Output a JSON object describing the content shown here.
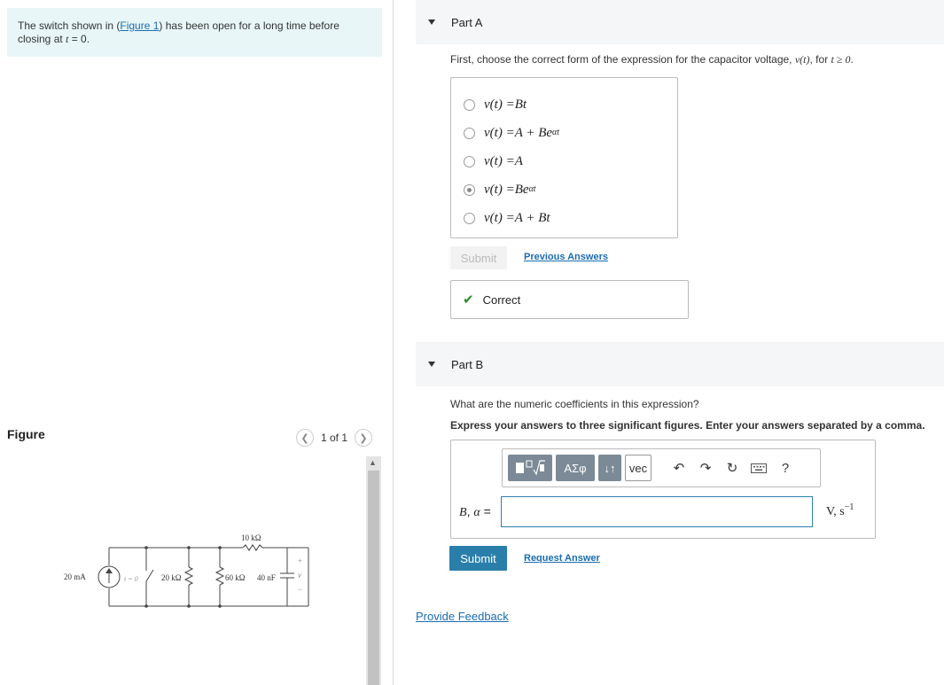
{
  "problem": {
    "text_before": "The switch shown in (",
    "figure_link": "Figure 1",
    "text_after": ") has been open for a long time before closing at ",
    "time_var": "t",
    "time_eq": " = 0."
  },
  "figure": {
    "label": "Figure",
    "pager": "1 of 1",
    "circuit": {
      "source": "20 mA",
      "switch": "t = 0",
      "r1": "20 kΩ",
      "r_top": "10 kΩ",
      "r2": "60 kΩ",
      "cap": "40 nF",
      "plus": "+",
      "v": "v",
      "minus": "−"
    }
  },
  "partA": {
    "title": "Part A",
    "question_prefix": "First, choose the correct form of the expression for the capacitor voltage, ",
    "question_var": "v(t)",
    "question_mid": ", for ",
    "question_cond": "t ≥ 0",
    "question_end": ".",
    "choices": [
      {
        "lhs": "v(t) = ",
        "rhs": "Bt",
        "sup": "",
        "selected": false
      },
      {
        "lhs": "v(t) = ",
        "rhs": "A + Be",
        "sup": "αt",
        "selected": false
      },
      {
        "lhs": "v(t) = ",
        "rhs": "A",
        "sup": "",
        "selected": false
      },
      {
        "lhs": "v(t) = ",
        "rhs": "Be",
        "sup": "αt",
        "selected": true
      },
      {
        "lhs": "v(t) = ",
        "rhs": "A + Bt",
        "sup": "",
        "selected": false
      }
    ],
    "submit_label": "Submit",
    "previous_answers": "Previous Answers",
    "result": "Correct"
  },
  "partB": {
    "title": "Part B",
    "question": "What are the numeric coefficients in this expression?",
    "instruction": "Express your answers to three significant figures. Enter your answers separated by a comma.",
    "toolbar": {
      "templates_icon": "templates-icon",
      "greek_label": "ΑΣφ",
      "updown_label": "↓↑",
      "vec_label": "vec"
    },
    "variable_label_b": "B",
    "variable_label_sep": ", ",
    "variable_label_alpha": "α",
    "variable_label_eq": " =",
    "input_value": "",
    "units": "V, s",
    "units_sup": "−1",
    "submit_label": "Submit",
    "request_answer": "Request Answer"
  },
  "footer": {
    "provide_feedback": "Provide Feedback"
  },
  "colors": {
    "accent": "#2a7faa",
    "link": "#1a6cb0",
    "problem_bg": "#e8f6f8",
    "correct": "#2e8b2e"
  }
}
